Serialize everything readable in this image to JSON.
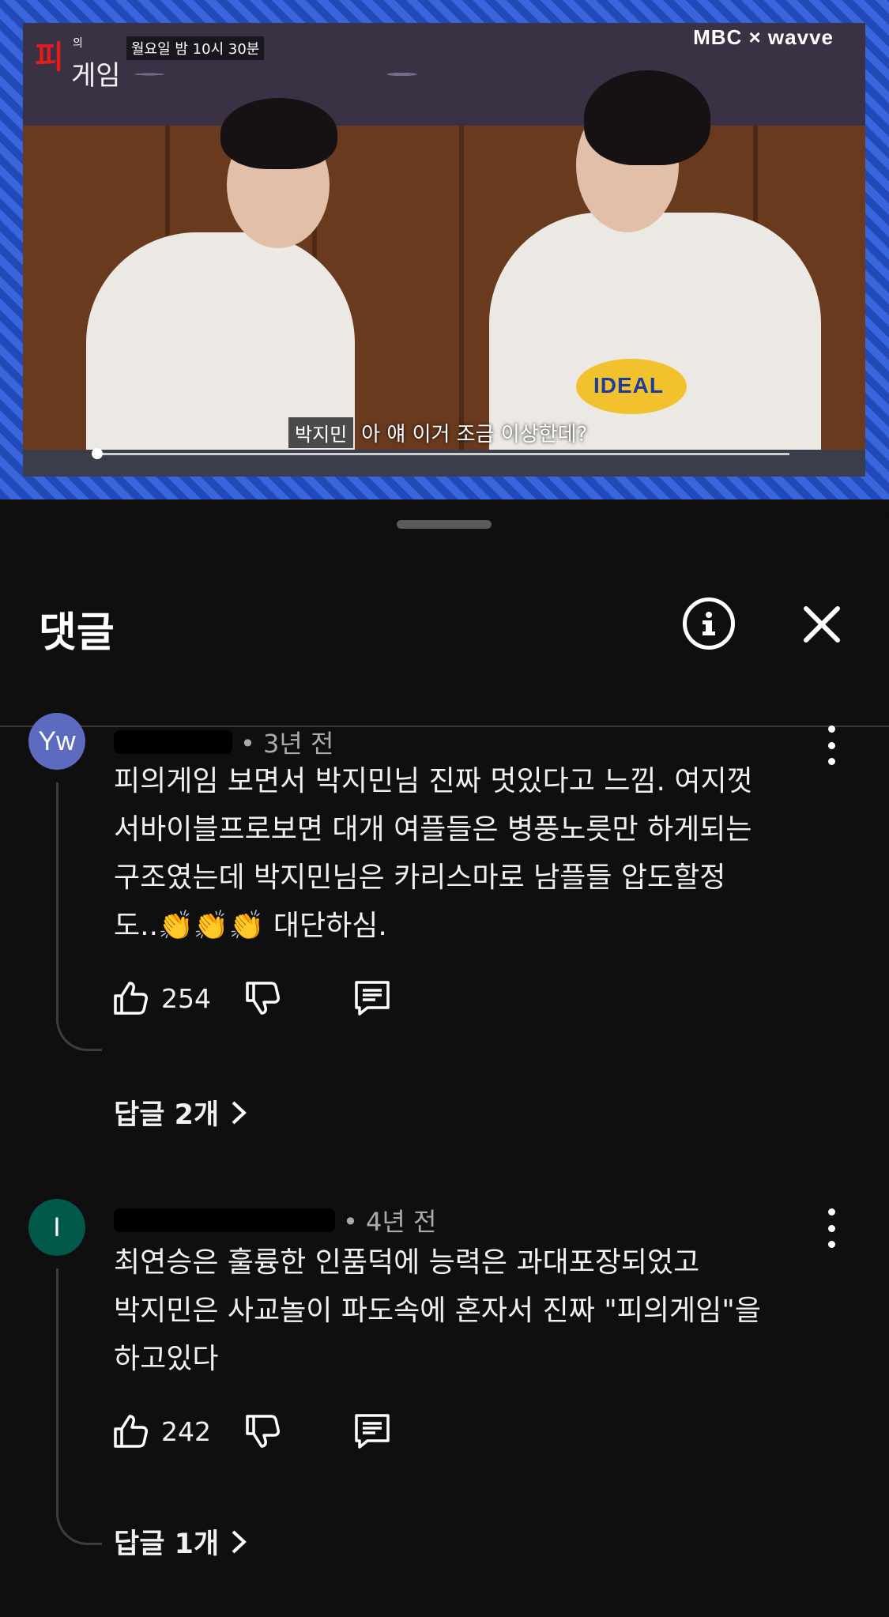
{
  "video": {
    "show_logo_red": "피",
    "show_logo_small": "의",
    "show_logo_white": "게임",
    "airtime": "월요일 밤 10시 30분",
    "brand": "MBC × wavve",
    "shirt_print": "IDEAL",
    "speaker": "박지민",
    "subtitle": "아 얘 이거 조금 이상한데?"
  },
  "sheet": {
    "title": "댓글",
    "info_icon": "info-icon",
    "close_icon": "close-icon"
  },
  "comments": [
    {
      "avatar_text": "Yw",
      "avatar_color": "#5c6bc0",
      "time": "• 3년 전",
      "text": "피의게임 보면서 박지민님 진짜 멋있다고 느낌. 여지껏\n서바이블프로보면 대개 여플들은 병풍노릇만 하게되는\n구조였는데 박지민님은 카리스마로 남플들 압도할정\n도..👏👏👏 대단하심.",
      "likes": "254",
      "replies": "답글 2개"
    },
    {
      "avatar_text": "I",
      "avatar_color": "#00594a",
      "time": "• 4년 전",
      "text": "최연승은 훌륭한 인품덕에 능력은 과대포장되었고\n박지민은 사교놀이 파도속에 혼자서 진짜 \"피의게임\"을\n하고있다",
      "likes": "242",
      "replies": "답글 1개"
    }
  ],
  "colors": {
    "background": "#0f0f0f",
    "text": "#f1f1f1",
    "secondary_text": "#aaaaaa"
  }
}
